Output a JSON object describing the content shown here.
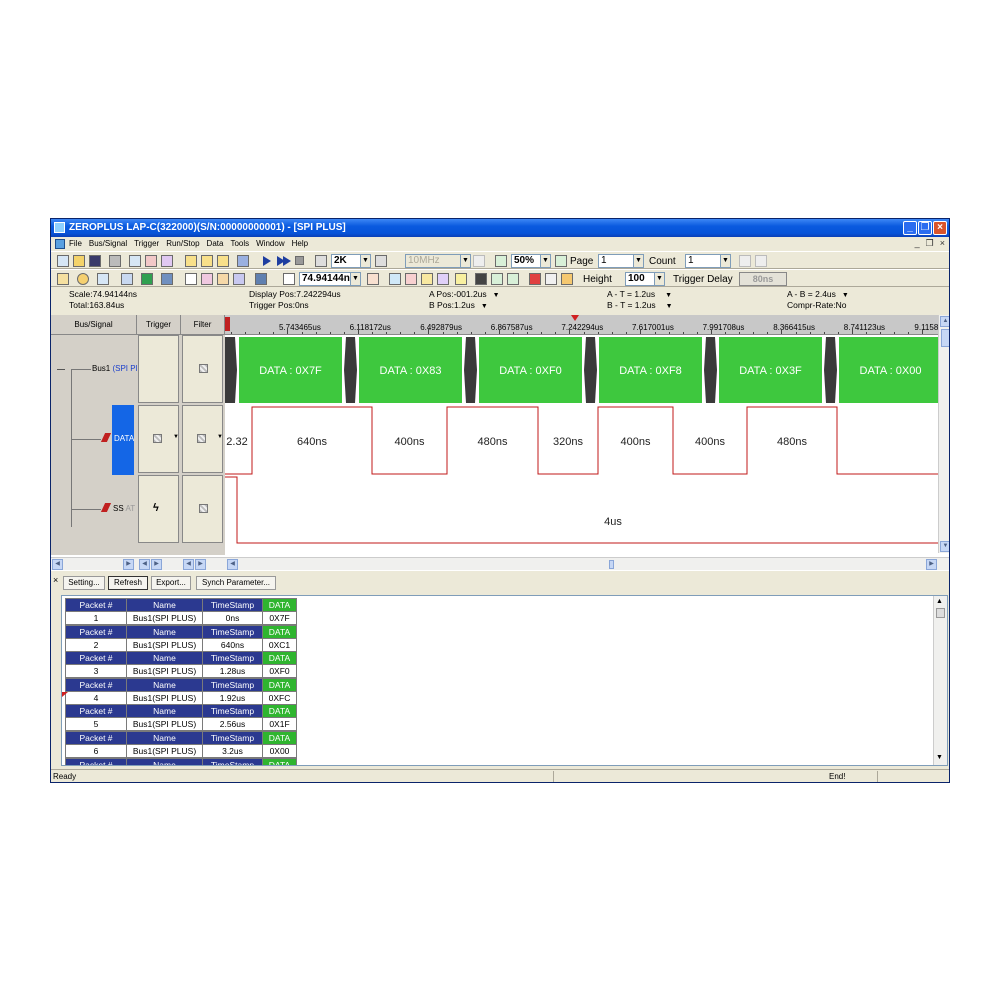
{
  "window": {
    "title": "ZEROPLUS LAP-C(322000)(S/N:00000000001) - [SPI PLUS]"
  },
  "menu": [
    "File",
    "Bus/Signal",
    "Trigger",
    "Run/Stop",
    "Data",
    "Tools",
    "Window",
    "Help"
  ],
  "toolbar": {
    "sample_depth": "2K",
    "sample_rate": "10MHz",
    "zoom": "50%",
    "page_label": "Page",
    "page_value": "1",
    "count_label": "Count",
    "count_value": "1",
    "scale_value": "74.94144n",
    "height_label": "Height",
    "height_value": "100",
    "trigger_delay_label": "Trigger Delay",
    "trigger_delay_value": "80ns"
  },
  "info": {
    "scale": "Scale:74.94144ns",
    "total": "Total:163.84us",
    "display_pos": "Display Pos:7.242294us",
    "trigger_pos": "Trigger Pos:0ns",
    "a_pos": "A Pos:-001.2us",
    "b_pos": "B Pos:1.2us",
    "a_t": "A - T = 1.2us",
    "b_t": "B - T = 1.2us",
    "a_b": "A - B = 2.4us",
    "compr_rate": "Compr-Rate:No"
  },
  "columns": {
    "bus_signal": "Bus/Signal",
    "trigger": "Trigger",
    "filter": "Filter"
  },
  "signals": {
    "bus_name": "Bus1",
    "bus_type": "(SPI Pl",
    "data_name": "DATA",
    "ss_name": "SS",
    "ss_suffix": "AT"
  },
  "ruler": {
    "ticks": [
      "5.743465us",
      "6.118172us",
      "6.492879us",
      "6.867587us",
      "7.242294us",
      "7.617001us",
      "7.991708us",
      "8.366415us",
      "8.741123us",
      "9.1158"
    ]
  },
  "wave": {
    "packets": [
      "DATA : 0X7F",
      "DATA : 0X83",
      "DATA : 0XF0",
      "DATA : 0XF8",
      "DATA : 0X3F",
      "DATA : 0X00"
    ],
    "data_intervals": [
      "2.32",
      "640ns",
      "400ns",
      "480ns",
      "320ns",
      "400ns",
      "400ns",
      "480ns"
    ],
    "ss_interval": "4us"
  },
  "buttons": {
    "setting": "Setting...",
    "refresh": "Refresh",
    "export": "Export...",
    "synch": "Synch Parameter..."
  },
  "packet_table": {
    "headers": [
      "Packet #",
      "Name",
      "TimeStamp",
      "DATA"
    ],
    "rows": [
      {
        "packet": "1",
        "name": "Bus1(SPI PLUS)",
        "time": "0ns",
        "data": "0X7F"
      },
      {
        "packet": "2",
        "name": "Bus1(SPI PLUS)",
        "time": "640ns",
        "data": "0XC1"
      },
      {
        "packet": "3",
        "name": "Bus1(SPI PLUS)",
        "time": "1.28us",
        "data": "0XF0"
      },
      {
        "packet": "4",
        "name": "Bus1(SPI PLUS)",
        "time": "1.92us",
        "data": "0XFC"
      },
      {
        "packet": "5",
        "name": "Bus1(SPI PLUS)",
        "time": "2.56us",
        "data": "0X1F"
      },
      {
        "packet": "6",
        "name": "Bus1(SPI PLUS)",
        "time": "3.2us",
        "data": "0X00"
      }
    ]
  },
  "status": {
    "left": "Ready",
    "right": "End!"
  }
}
